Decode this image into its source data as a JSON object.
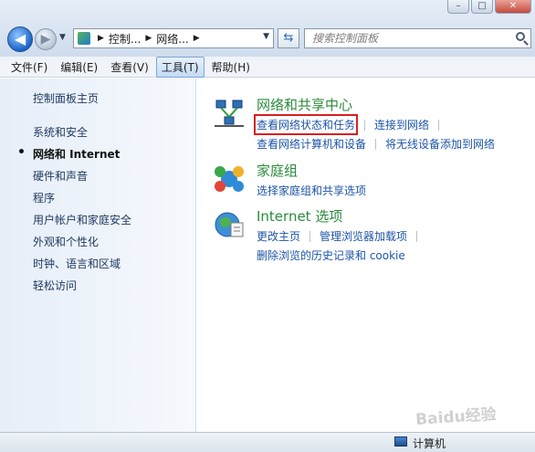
{
  "window_controls": {
    "minimize": "–",
    "maximize": "□",
    "close": "✕"
  },
  "address_bar": {
    "crumbs": [
      "控制...",
      "网络..."
    ],
    "icon": "control-panel-icon"
  },
  "search": {
    "placeholder": "搜索控制面板"
  },
  "menu": [
    "文件(F)",
    "编辑(E)",
    "查看(V)",
    "工具(T)",
    "帮助(H)"
  ],
  "menu_active_index": 3,
  "left_pane": {
    "home": "控制面板主页",
    "items": [
      "系统和安全",
      "网络和 Internet",
      "硬件和声音",
      "程序",
      "用户帐户和家庭安全",
      "外观和个性化",
      "时钟、语言和区域",
      "轻松访问"
    ],
    "current_index": 1
  },
  "main": {
    "groups": [
      {
        "title": "网络和共享中心",
        "icon": "network-sharing-icon",
        "rows": [
          [
            "查看网络状态和任务",
            "连接到网络"
          ],
          [
            "查看网络计算机和设备",
            "将无线设备添加到网络"
          ]
        ]
      },
      {
        "title": "家庭组",
        "icon": "homegroup-icon",
        "rows": [
          [
            "选择家庭组和共享选项"
          ]
        ]
      },
      {
        "title": "Internet 选项",
        "icon": "internet-options-icon",
        "rows": [
          [
            "更改主页",
            "管理浏览器加载项"
          ],
          [
            "删除浏览的历史记录和 cookie"
          ]
        ]
      }
    ],
    "highlighted_link": "查看网络状态和任务",
    "highlight_color": "#d8201e"
  },
  "status_bar": {
    "text": "计算机"
  },
  "watermark": "Baidu经验"
}
